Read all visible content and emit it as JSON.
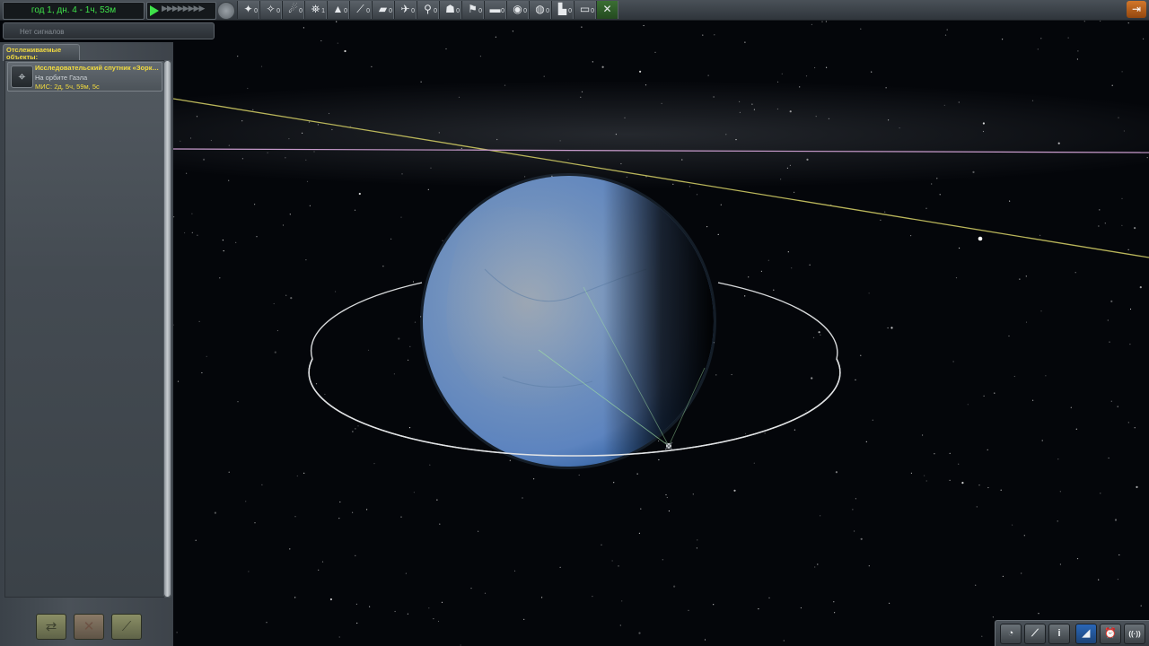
{
  "header": {
    "date": "год 1, дн. 4 - 1ч, 53м",
    "signal": "Нет сигналов"
  },
  "filters": [
    {
      "icon": "debris-icon",
      "glyph": "✦",
      "count": "0"
    },
    {
      "icon": "unknown-object-icon",
      "glyph": "✧",
      "count": "0"
    },
    {
      "icon": "space-object-icon",
      "glyph": "☄",
      "count": "0"
    },
    {
      "icon": "probe-icon",
      "glyph": "⛯",
      "count": "1"
    },
    {
      "icon": "rover-icon",
      "glyph": "▲",
      "count": "0"
    },
    {
      "icon": "lander-icon",
      "glyph": "⟋",
      "count": "0"
    },
    {
      "icon": "ship-icon",
      "glyph": "▰",
      "count": "0"
    },
    {
      "icon": "plane-icon",
      "glyph": "✈",
      "count": "0"
    },
    {
      "icon": "relay-icon",
      "glyph": "⚲",
      "count": "0"
    },
    {
      "icon": "eva-icon",
      "glyph": "☗",
      "count": "0"
    },
    {
      "icon": "flag-icon",
      "glyph": "⚑",
      "count": "0"
    },
    {
      "icon": "station-icon",
      "glyph": "▬",
      "count": "0"
    },
    {
      "icon": "base-icon",
      "glyph": "◉",
      "count": "0"
    },
    {
      "icon": "spaceobject-icon",
      "glyph": "◍",
      "count": "0"
    },
    {
      "icon": "dropped-part-icon",
      "glyph": "▙",
      "count": "0"
    },
    {
      "icon": "deployed-science-icon",
      "glyph": "▭",
      "count": "0"
    },
    {
      "icon": "toggle-all-icon",
      "glyph": "✕",
      "count": ""
    }
  ],
  "sidebar": {
    "tab_label": "Отслеживаемые объекты:",
    "vessel": {
      "icon": "probe-icon",
      "name": "Исследовательский спутник «Зоркий»",
      "status": "На орбите Гаэла",
      "met": "МИС: 2д, 5ч, 59м, 5с"
    },
    "buttons": [
      {
        "name": "fly-button",
        "glyph": "⇄"
      },
      {
        "name": "terminate-button",
        "glyph": "✕"
      },
      {
        "name": "recover-button",
        "glyph": "⟋"
      }
    ]
  },
  "bottom_bar": [
    {
      "name": "clock-button",
      "glyph": "◔"
    },
    {
      "name": "maneuver-button",
      "glyph": "⟋"
    },
    {
      "name": "info-button",
      "glyph": "i"
    },
    {
      "name": "commnet-button",
      "glyph": "◢"
    },
    {
      "name": "alarm-clock-button",
      "glyph": "⏰"
    },
    {
      "name": "signal-button",
      "glyph": "((·))"
    }
  ],
  "colors": {
    "date_text": "#3fe24a",
    "vessel_name": "#f3dc3e",
    "orbit_yellow": "#b9b55a",
    "orbit_pink": "#c99ccd",
    "planet": "#6f95c4"
  }
}
